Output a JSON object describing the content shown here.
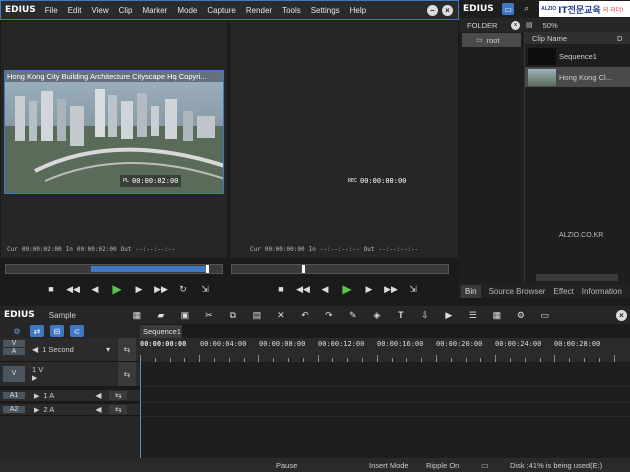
{
  "app": {
    "logo": "EDIUS"
  },
  "menu": [
    "File",
    "Edit",
    "View",
    "Clip",
    "Marker",
    "Mode",
    "Capture",
    "Render",
    "Tools",
    "Settings",
    "Help"
  ],
  "player": {
    "overlay_title": "Hong Kong City Building Architecture Cityscape Hq Copyri...",
    "timecode": "00:00:02:00",
    "timecode_prefix": "PL",
    "cur_label": "Cur",
    "cur_value": "00:00:02:00",
    "in_label": "In",
    "in_value": "00:00:02:00",
    "out_label": "Out",
    "out_value": "--:--:--:--"
  },
  "recorder": {
    "timecode": "00:00:00:00",
    "timecode_prefix": "REC",
    "cur_label": "Cur",
    "cur_value": "00:00:00:00",
    "in_label": "In",
    "in_value": "--:--:--:--",
    "out_label": "Out",
    "out_value": "--:--:--:--"
  },
  "bin": {
    "logo": "EDIUS",
    "ad_small": "ALZIO",
    "ad_main": "IT전문교육",
    "ad_suffix": "의 리더!",
    "folder_label": "FOLDER",
    "zoom": "50%",
    "col_name": "Clip Name",
    "col_d": "D",
    "root": "root",
    "watermark": "ALZIO.CO.KR",
    "clips": [
      {
        "name": "Sequence1"
      },
      {
        "name": "Hong Kong Cl..."
      }
    ],
    "tabs": [
      "Bin",
      "Source Browser",
      "Effect",
      "Information"
    ]
  },
  "timeline": {
    "logo": "EDIUS",
    "project": "Sample",
    "sequence_tab": "Sequence1",
    "scale": "1 Second",
    "ruler": [
      "00:00:00:00",
      "00:00:04:00",
      "00:00:08:00",
      "00:00:12:00",
      "00:00:16:00",
      "00:00:20:00",
      "00:00:24:00",
      "00:00:28:00"
    ],
    "tracks": [
      {
        "badge": "V",
        "name": "1 V"
      },
      {
        "badge": "A1",
        "name": "1 A"
      },
      {
        "badge": "A2",
        "name": "2 A"
      }
    ],
    "va_badge_v": "V",
    "va_badge_a": "A"
  },
  "status": {
    "state": "Pause",
    "mode": "Insert Mode",
    "ripple": "Ripple On",
    "disk": "Disk :41% is being used(E:)"
  }
}
